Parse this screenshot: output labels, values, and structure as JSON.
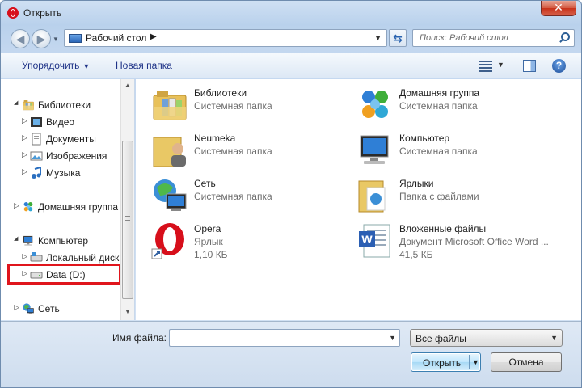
{
  "window": {
    "title": "Открыть",
    "close_symbol": "✕"
  },
  "nav": {
    "back_symbol": "◀",
    "forward_symbol": "▶",
    "address": {
      "path": "Рабочий стол",
      "separator": "▶"
    },
    "refresh_symbol": "⇆",
    "search": {
      "placeholder": "Поиск: Рабочий стол"
    }
  },
  "toolbar": {
    "organize_label": "Упорядочить",
    "new_folder_label": "Новая папка",
    "help_symbol": "?"
  },
  "tree": {
    "items": [
      {
        "label": "Библиотеки",
        "icon": "libraries-icon",
        "expanded": true
      },
      {
        "label": "Видео",
        "icon": "video-library-icon"
      },
      {
        "label": "Документы",
        "icon": "documents-library-icon"
      },
      {
        "label": "Изображения",
        "icon": "pictures-library-icon"
      },
      {
        "label": "Музыка",
        "icon": "music-library-icon"
      },
      {
        "label": "Домашняя группа",
        "icon": "homegroup-icon"
      },
      {
        "label": "Компьютер",
        "icon": "computer-icon",
        "expanded": true
      },
      {
        "label": "Локальный диск",
        "icon": "local-disk-icon"
      },
      {
        "label": "Data (D:)",
        "icon": "drive-icon",
        "highlighted": true
      },
      {
        "label": "Сеть",
        "icon": "network-icon"
      }
    ]
  },
  "files": [
    {
      "name": "Библиотеки",
      "type": "Системная папка",
      "icon": "libraries-icon"
    },
    {
      "name": "Домашняя группа",
      "type": "Системная папка",
      "icon": "homegroup-icon"
    },
    {
      "name": "Neumeka",
      "type": "Системная папка",
      "icon": "user-folder-icon"
    },
    {
      "name": "Компьютер",
      "type": "Системная папка",
      "icon": "computer-icon"
    },
    {
      "name": "Сеть",
      "type": "Системная папка",
      "icon": "network-icon"
    },
    {
      "name": "Ярлыки",
      "type": "Папка с файлами",
      "icon": "shortcuts-folder-icon"
    },
    {
      "name": "Opera",
      "type": "Ярлык",
      "size": "1,10 КБ",
      "icon": "opera-icon"
    },
    {
      "name": "Вложенные файлы",
      "type": "Документ Microsoft Office Word ...",
      "size": "41,5 КБ",
      "icon": "word-document-icon"
    }
  ],
  "footer": {
    "filename_label": "Имя файла:",
    "filename_value": "",
    "filter_value": "Все файлы",
    "open_label": "Открыть",
    "cancel_label": "Отмена"
  },
  "colors": {
    "highlight": "#e0151c",
    "link_text": "#1e3287",
    "opera_red": "#d70f1b"
  }
}
